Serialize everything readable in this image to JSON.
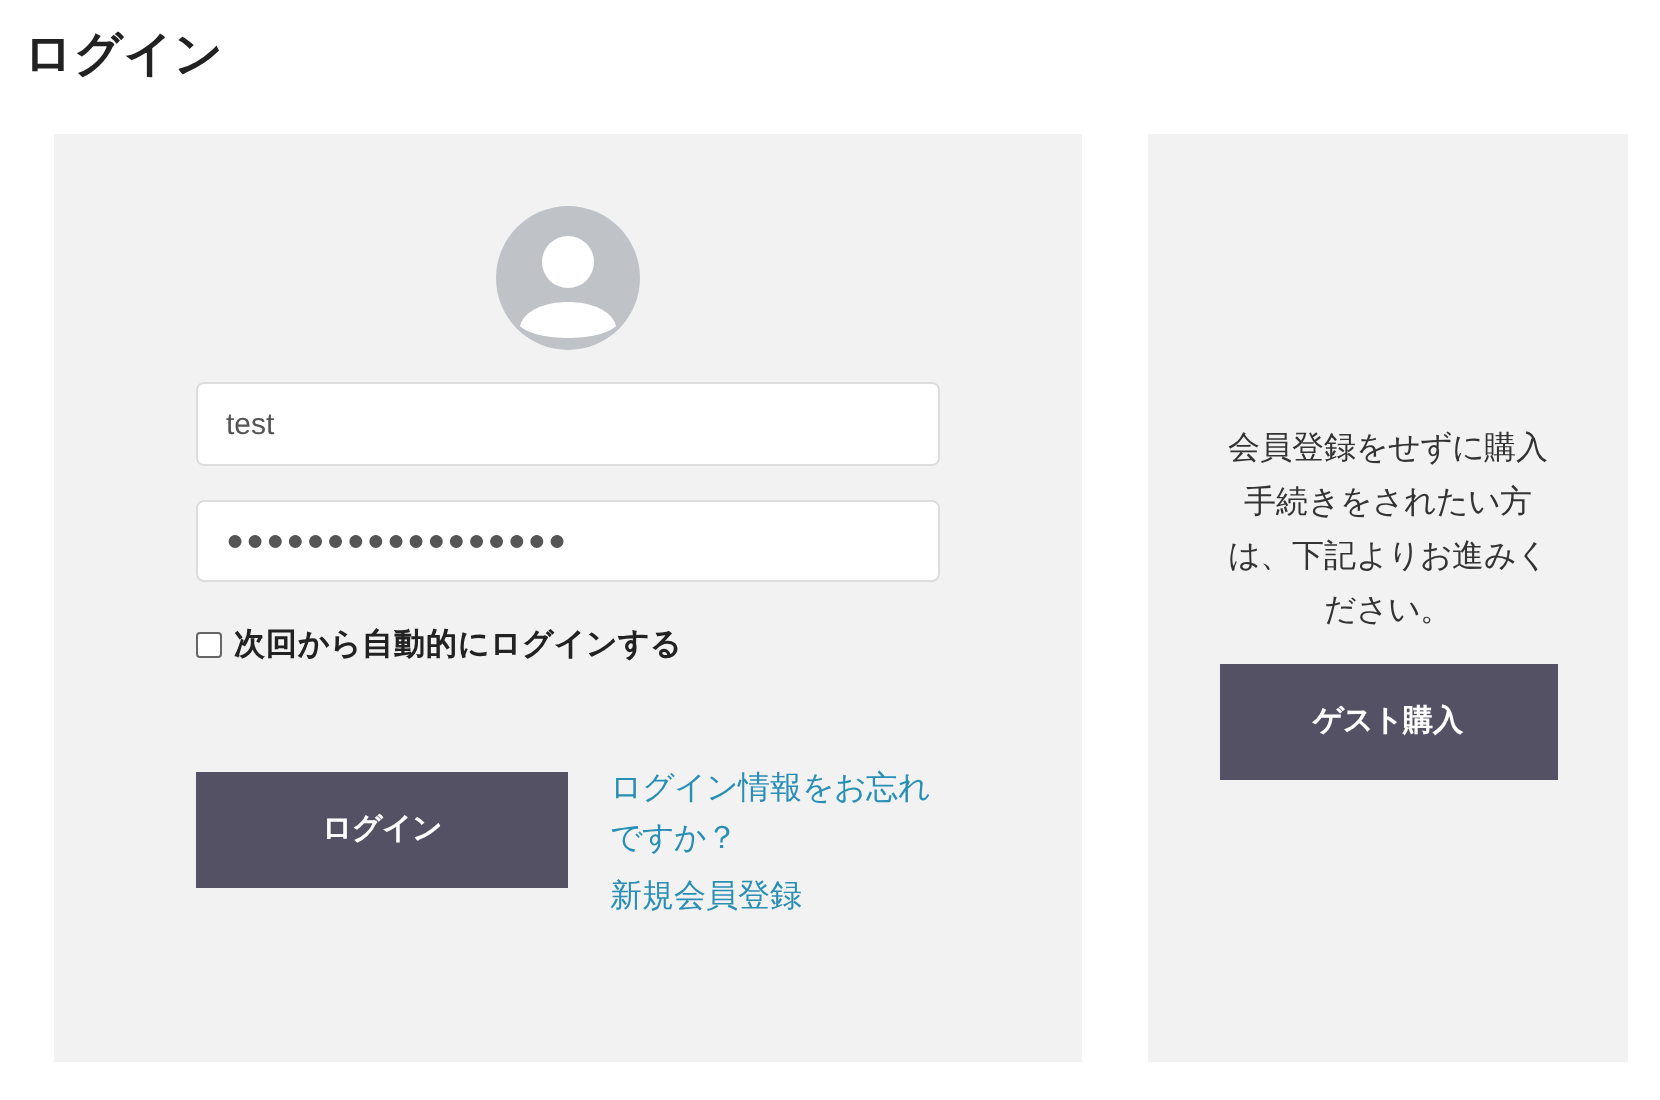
{
  "title": "ログイン",
  "login": {
    "username": {
      "value": "test"
    },
    "password": {
      "value": "●●●●●●●●●●●●●●●●●"
    },
    "remember": {
      "label": "次回から自動的にログインする",
      "checked": false
    },
    "submit": "ログイン",
    "forgot_link": "ログイン情報をお忘れですか？",
    "register_link": "新規会員登録"
  },
  "guest": {
    "message": "会員登録をせずに購入手続きをされたい方は、下記よりお進みください。",
    "button": "ゲスト購入"
  }
}
